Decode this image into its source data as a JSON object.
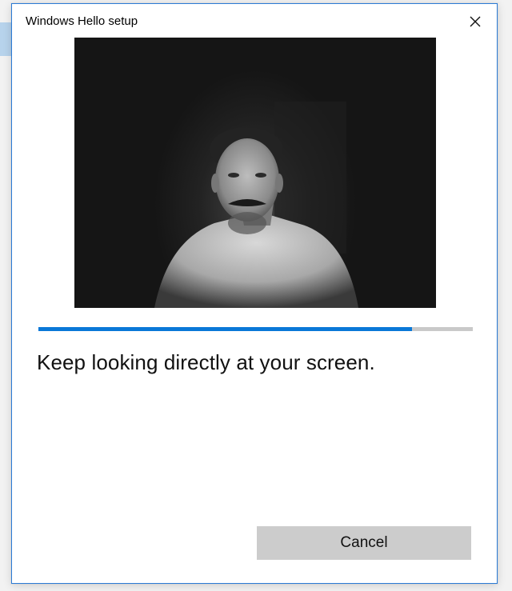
{
  "dialog": {
    "title": "Windows Hello setup",
    "close_icon": "close-icon",
    "camera_preview": "webcam-feed-image",
    "progress_value": 0.86,
    "accent_color": "#0a78d7",
    "instruction": "Keep looking directly at your screen.",
    "cancel_label": "Cancel"
  }
}
